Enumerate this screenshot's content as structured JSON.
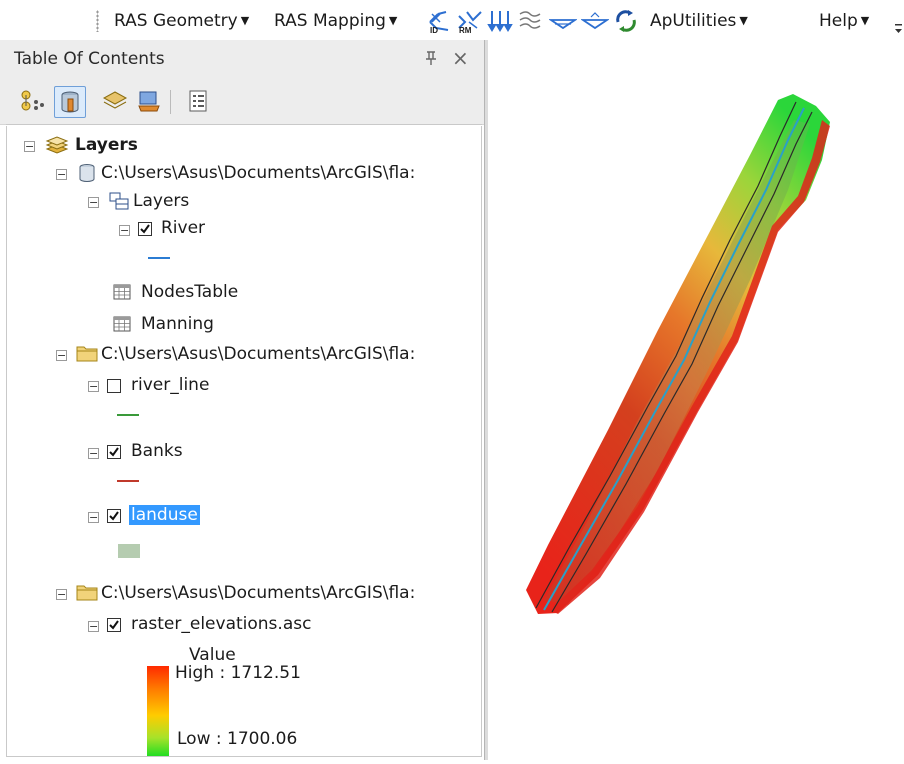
{
  "toolbar": {
    "menus": [
      {
        "label": "RAS Geometry"
      },
      {
        "label": "RAS Mapping"
      },
      {
        "label": "ApUtilities"
      },
      {
        "label": "Help"
      }
    ],
    "icons": [
      "river-id-icon",
      "river-rm-icon",
      "flow-arrows-icon",
      "cross-sections-icon",
      "water-surface-icon",
      "water-surface-2-icon",
      "sync-icon"
    ]
  },
  "toc": {
    "title": "Table Of Contents",
    "pin_glyph": "⊥",
    "close_glyph": "×",
    "tools": [
      "list-by-drawing-order-icon",
      "list-by-source-icon",
      "list-by-visibility-icon",
      "list-by-selection-icon",
      "options-icon"
    ],
    "tree": {
      "root": "Layers",
      "gdb_path": "C:\\Users\\Asus\\Documents\\ArcGIS\\fla:",
      "gdb_group": "Layers",
      "river": "River",
      "nodes_table": "NodesTable",
      "manning": "Manning",
      "folder1_path": "C:\\Users\\Asus\\Documents\\ArcGIS\\fla:",
      "river_line": "river_line",
      "banks": "Banks",
      "landuse": "landuse",
      "folder2_path": "C:\\Users\\Asus\\Documents\\ArcGIS\\fla:",
      "raster": "raster_elevations.asc",
      "legend_title": "Value",
      "legend_high": "High : 1712.51",
      "legend_low": "Low : 1700.06"
    },
    "checked": {
      "river": true,
      "river_line": false,
      "banks": true,
      "landuse": true,
      "raster": true
    }
  },
  "colors": {
    "river_symbol": "#2b7cd3",
    "river_line_symbol": "#3a9a3a",
    "banks_symbol": "#c0392b",
    "landuse_symbol": "#b5ccb0",
    "selection": "#3399ff",
    "ramp_high": "#ff2a00",
    "ramp_mid": "#ffcc00",
    "ramp_low": "#22dd22"
  }
}
